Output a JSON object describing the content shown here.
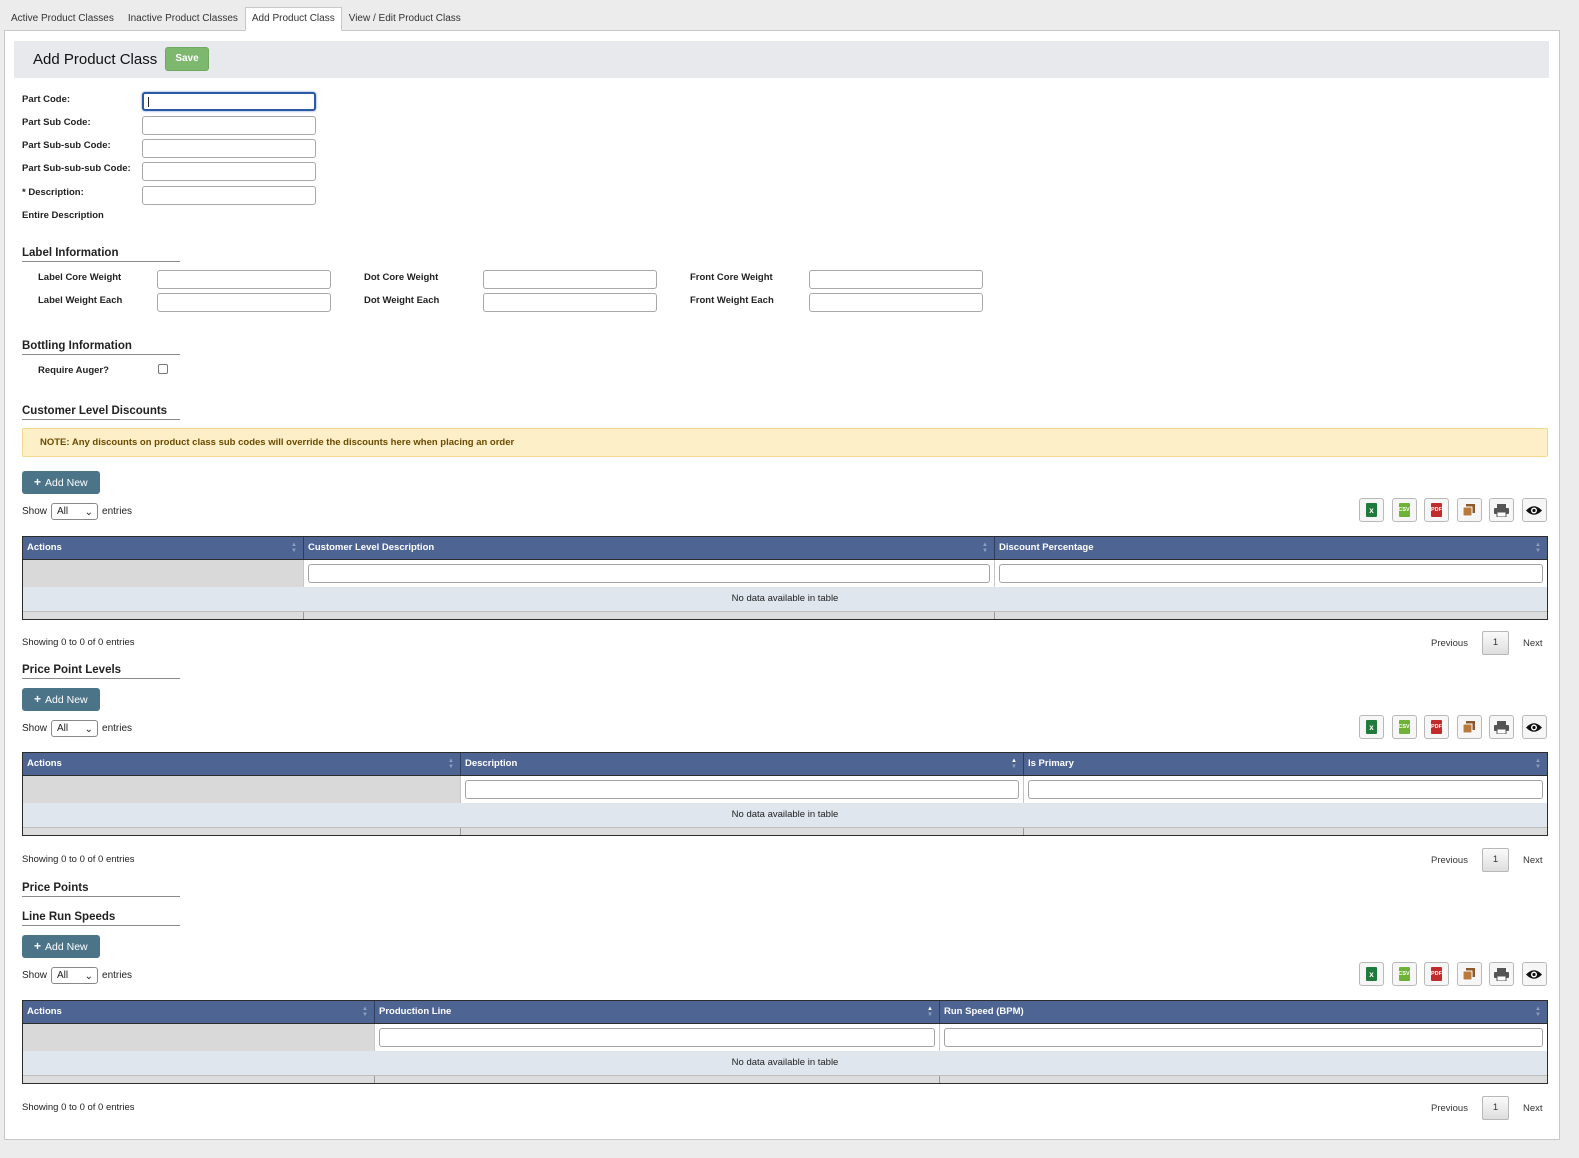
{
  "tabs": [
    "Active Product Classes",
    "Inactive Product Classes",
    "Add Product Class",
    "View / Edit Product Class"
  ],
  "header": {
    "title": "Add Product Class",
    "save_label": "Save"
  },
  "form": {
    "part_code": "Part Code:",
    "part_sub_code": "Part Sub Code:",
    "part_subsub_code": "Part Sub-sub Code:",
    "part_subsubsub_code": "Part Sub-sub-sub Code:",
    "description": "* Description:",
    "entire_description": "Entire Description"
  },
  "label_info": {
    "title": "Label Information",
    "label_core_weight": "Label Core Weight",
    "label_weight_each": "Label Weight Each",
    "dot_core_weight": "Dot Core Weight",
    "dot_weight_each": "Dot Weight Each",
    "front_core_weight": "Front Core Weight",
    "front_weight_each": "Front Weight Each"
  },
  "bottling": {
    "title": "Bottling Information",
    "require_auger": "Require Auger?"
  },
  "discounts": {
    "title": "Customer Level Discounts",
    "note": "NOTE: Any discounts on product class sub codes will override the discounts here when placing an order",
    "columns": [
      "Actions",
      "Customer Level Description",
      "Discount Percentage"
    ]
  },
  "price_point_levels": {
    "title": "Price Point Levels",
    "columns": [
      "Actions",
      "Description",
      "Is Primary"
    ]
  },
  "price_points": {
    "title": "Price Points"
  },
  "line_run_speeds": {
    "title": "Line Run Speeds",
    "columns": [
      "Actions",
      "Production Line",
      "Run Speed (BPM)"
    ]
  },
  "common": {
    "add_new": "Add New",
    "show": "Show",
    "entries": "entries",
    "page_length": "All",
    "no_data": "No data available in table",
    "showing": "Showing 0 to 0 of 0 entries",
    "previous": "Previous",
    "next": "Next",
    "page": "1"
  },
  "export_icons": [
    "excel-icon",
    "csv-icon",
    "pdf-icon",
    "copy-icon",
    "print-icon",
    "column-visibility-icon"
  ],
  "colors": {
    "table_header": "#4e6594",
    "add_button": "#4c7489",
    "save_button": "#7eb86e",
    "note_bg": "#fdefc8"
  }
}
